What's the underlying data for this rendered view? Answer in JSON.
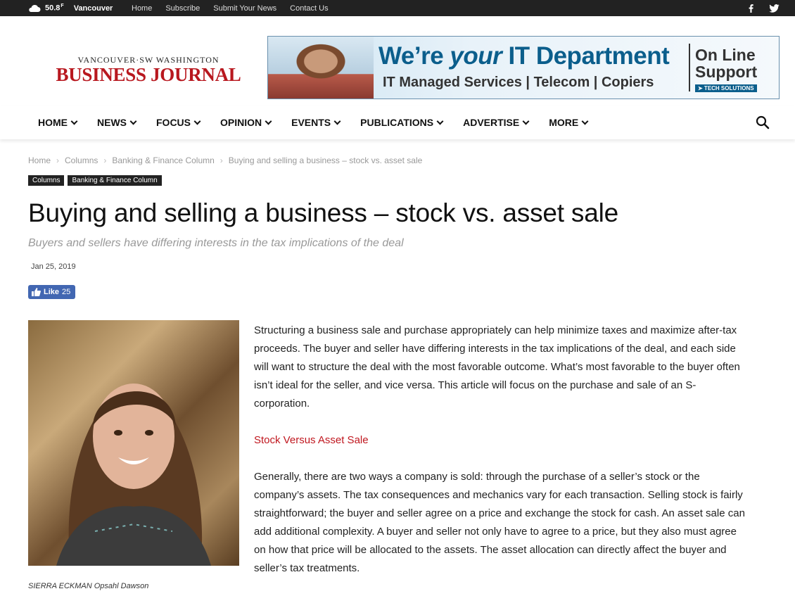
{
  "topbar": {
    "temperature": "50.8",
    "temp_unit": "F",
    "city": "Vancouver",
    "links": [
      "Home",
      "Subscribe",
      "Submit Your News",
      "Contact Us"
    ]
  },
  "logo": {
    "top_line": "VANCOUVER·SW WASHINGTON",
    "main": "BUSINESS JOURNAL"
  },
  "ad": {
    "headline_pre": "We’re ",
    "headline_em": "your",
    "headline_post": " IT Department",
    "subline": "IT Managed Services | Telecom | Copiers",
    "support_line1": "On Line",
    "support_line2": "Support",
    "tech": "➤ TECH SOLUTIONS"
  },
  "nav": {
    "items": [
      "HOME",
      "NEWS",
      "FOCUS",
      "OPINION",
      "EVENTS",
      "PUBLICATIONS",
      "ADVERTISE",
      "MORE"
    ]
  },
  "breadcrumb": [
    "Home",
    "Columns",
    "Banking & Finance Column",
    "Buying and selling a business – stock vs. asset sale"
  ],
  "tags": [
    "Columns",
    "Banking & Finance Column"
  ],
  "article": {
    "title": "Buying and selling a business – stock vs. asset sale",
    "subtitle": "Buyers and sellers have differing interests in the tax implications of the deal",
    "date": "Jan 25, 2019",
    "like_label": "Like",
    "like_count": "25",
    "caption": "SIERRA ECKMAN Opsahl Dawson",
    "para1": "Structuring a business sale and purchase appropriately can help minimize taxes and maximize after-tax proceeds. The buyer and seller have differing interests in the tax implications of the deal, and each side will want to structure the deal with the most favorable outcome. What’s most favorable to the buyer often isn’t ideal for the seller, and vice versa. This article will focus on the purchase and sale of an S-corporation.",
    "section_heading": "Stock Versus Asset Sale",
    "para2": "Generally, there are two ways a company is sold: through the purchase of a seller’s stock or the company’s assets. The tax consequences and mechanics vary for each transaction. Selling stock is fairly straightforward; the buyer and seller agree on a price and exchange the stock for cash. An asset sale can add additional complexity. A buyer and seller not only have to agree to a price, but they also must agree on how that price will be allocated to the assets. The asset allocation can directly affect the buyer and seller’s tax treatments."
  },
  "colors": {
    "accent_red": "#c0171f",
    "topbar_bg": "#222222",
    "facebook_blue": "#4267b2"
  }
}
